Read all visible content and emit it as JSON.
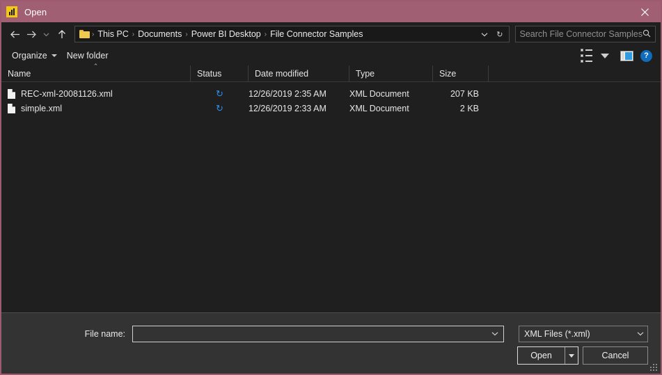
{
  "window": {
    "title": "Open",
    "app_icon": "power-bi-icon",
    "close_icon": "close-icon",
    "accent_color": "#a05f73",
    "background_color": "#333333",
    "list_background_color": "#1f1f1f"
  },
  "nav": {
    "back_icon": "back-arrow-icon",
    "forward_icon": "forward-arrow-icon",
    "recent_icon": "chevron-down-icon",
    "up_icon": "up-arrow-icon",
    "breadcrumb": {
      "folder_icon": "folder-icon",
      "separator": "›",
      "items": [
        "This PC",
        "Documents",
        "Power BI Desktop",
        "File Connector Samples"
      ],
      "dropdown_icon": "chevron-down-icon",
      "refresh_icon": "refresh-icon",
      "refresh_glyph": "↻"
    },
    "search": {
      "placeholder": "Search File Connector Samples",
      "icon": "search-icon",
      "value": ""
    }
  },
  "toolbar": {
    "organize_label": "Organize",
    "new_folder_label": "New folder",
    "view_options_icon": "details-view-icon",
    "preview_pane_icon": "preview-pane-icon",
    "help_icon": "help-icon",
    "help_label": "?"
  },
  "file_table": {
    "columns": [
      {
        "label": "Name",
        "sorted": "asc",
        "sort_glyph": "⌃"
      },
      {
        "label": "Status"
      },
      {
        "label": "Date modified"
      },
      {
        "label": "Type"
      },
      {
        "label": "Size"
      }
    ],
    "rows": [
      {
        "icon": "xml-document-icon",
        "name": "REC-xml-20081126.xml",
        "status_icon": "sync-pending-icon",
        "status_glyph": "↻",
        "date_modified": "12/26/2019 2:35 AM",
        "type": "XML Document",
        "size": "207 KB"
      },
      {
        "icon": "xml-document-icon",
        "name": "simple.xml",
        "status_icon": "sync-pending-icon",
        "status_glyph": "↻",
        "date_modified": "12/26/2019 2:33 AM",
        "type": "XML Document",
        "size": "2 KB"
      }
    ]
  },
  "footer": {
    "file_name_label": "File name:",
    "file_name_value": "",
    "file_name_placeholder": "",
    "file_name_dropdown_icon": "chevron-down-icon",
    "filter_value": "XML Files (*.xml)",
    "filter_dropdown_icon": "chevron-down-icon",
    "open_label": "Open",
    "open_split_icon": "caret-down-icon",
    "cancel_label": "Cancel",
    "resize_grip_icon": "resize-grip-icon"
  }
}
